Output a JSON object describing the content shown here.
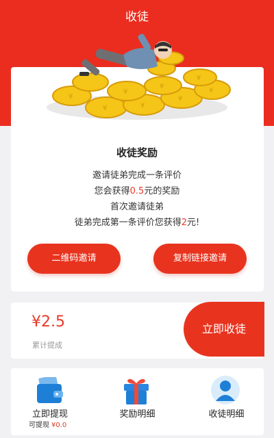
{
  "header": {
    "title": "收徒"
  },
  "reward": {
    "title": "收徒奖励",
    "line1": "邀请徒弟完成一条评价",
    "line2_prefix": "您会获得",
    "line2_amount": "0.5",
    "line2_suffix": "元的奖励",
    "line3": "首次邀请徒弟",
    "line4_prefix": "徒弟完成第一条评价您获得",
    "line4_amount": "2",
    "line4_suffix": "元!"
  },
  "buttons": {
    "qr_invite": "二维码邀请",
    "link_invite": "复制链接邀请",
    "recruit_now": "立即收徒"
  },
  "earnings": {
    "amount": "¥2.5",
    "label": "累计提成"
  },
  "bottom": {
    "withdraw_label": "立即提现",
    "withdrawable_label": "可提现",
    "withdrawable_value": "¥0.0",
    "reward_detail_label": "奖励明细",
    "apprentice_detail_label": "收徒明细"
  },
  "colors": {
    "primary": "#ea2d1f",
    "accent_text": "#e63a2b",
    "icon_blue": "#1e7fd6",
    "gift_red": "#f04a3a"
  },
  "icons": [
    "wallet-icon",
    "gift-icon",
    "user-icon"
  ]
}
